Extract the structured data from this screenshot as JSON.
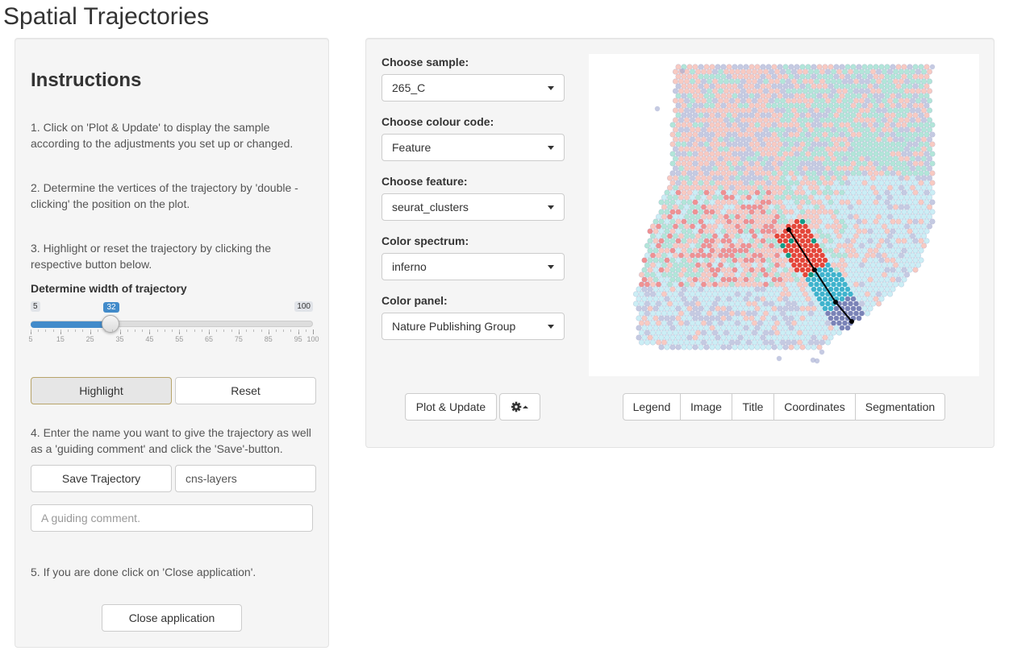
{
  "app": {
    "title": "Spatial Trajectories"
  },
  "instructions": {
    "heading": "Instructions",
    "step1": "1. Click on 'Plot & Update' to display the sample according to the adjustments you set up or changed.",
    "step2": "2. Determine the vertices of the trajectory by 'double -clicking' the position on the plot.",
    "step3": "3. Highlight or reset the trajectory by clicking the respective button below.",
    "width_label": "Determine width of trajectory",
    "slider": {
      "min": 5,
      "max": 100,
      "value": 32,
      "min_label": "5",
      "max_label": "100",
      "value_label": "32",
      "tick_labels": [
        "5",
        "15",
        "25",
        "35",
        "45",
        "55",
        "65",
        "75",
        "85",
        "95",
        "100"
      ]
    },
    "highlight_button": "Highlight",
    "reset_button": "Reset",
    "step4": "4. Enter the name you want to give the trajectory as well as a 'guiding comment' and click the 'Save'-button.",
    "save_button": "Save Trajectory",
    "trajectory_name_value": "cns-layers",
    "comment_placeholder": "A guiding comment.",
    "step5": "5. If you are done click on 'Close application'.",
    "close_button": "Close application"
  },
  "controls": {
    "sample": {
      "label": "Choose sample:",
      "value": "265_C"
    },
    "colour_code": {
      "label": "Choose colour code:",
      "value": "Feature"
    },
    "feature": {
      "label": "Choose feature:",
      "value": "seurat_clusters"
    },
    "color_spectrum": {
      "label": "Color spectrum:",
      "value": "inferno"
    },
    "color_panel": {
      "label": "Color panel:",
      "value": "Nature Publishing Group"
    }
  },
  "plot_buttons": {
    "plot_update": "Plot & Update",
    "settings_icon": "gear-icon",
    "toggles": [
      "Legend",
      "Image",
      "Title",
      "Coordinates",
      "Segmentation"
    ]
  },
  "plot": {
    "cluster_colors": [
      "#f4a79a",
      "#e6474a",
      "#7fd6c0",
      "#9ea6cf",
      "#a9e3ee",
      "#48b7cc",
      "#159c85",
      "#7a83b7"
    ],
    "trajectory_color": "#000000",
    "highlight_colors": [
      "#e4463a",
      "#3fb3cd"
    ]
  }
}
